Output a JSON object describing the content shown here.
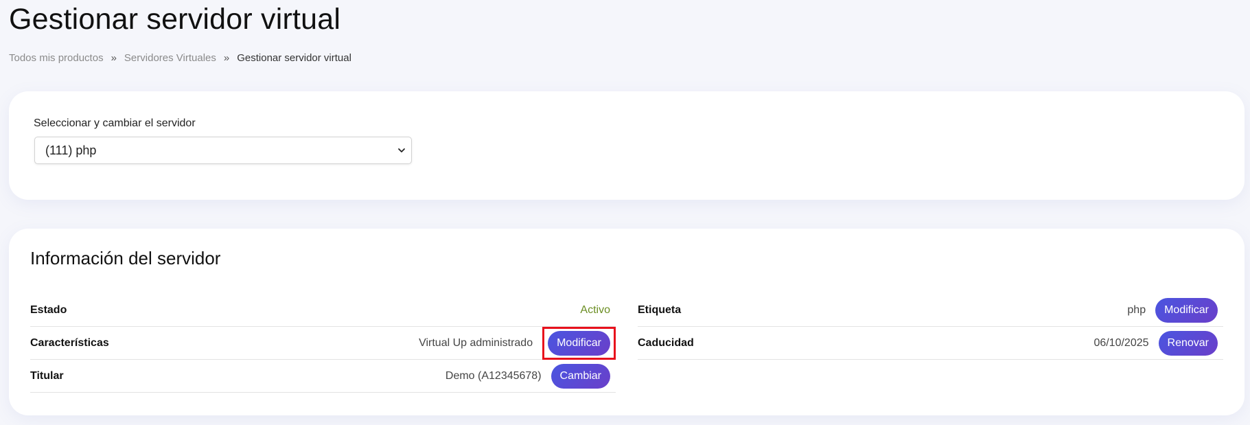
{
  "page": {
    "title": "Gestionar servidor virtual"
  },
  "breadcrumb": {
    "items": [
      "Todos mis productos",
      "Servidores Virtuales"
    ],
    "separator": "»",
    "current": "Gestionar servidor virtual"
  },
  "server_select": {
    "label": "Seleccionar y cambiar el servidor",
    "selected": "(111) php"
  },
  "info": {
    "title": "Información del servidor",
    "left_rows": [
      {
        "label": "Estado",
        "value": "Activo",
        "status_color": "#6b8e23"
      },
      {
        "label": "Características",
        "value": "Virtual Up administrado",
        "button": "Modificar"
      },
      {
        "label": "Titular",
        "value": "Demo (A12345678)",
        "button": "Cambiar"
      }
    ],
    "right_rows": [
      {
        "label": "Etiqueta",
        "value": "php",
        "button": "Modificar"
      },
      {
        "label": "Caducidad",
        "value": "06/10/2025",
        "button": "Renovar"
      }
    ]
  },
  "colors": {
    "accent_gradient_start": "#4a55e0",
    "accent_gradient_end": "#6a3fc9",
    "highlight": "#e8111c"
  },
  "icons": {
    "select": "chevron-down-icon"
  }
}
